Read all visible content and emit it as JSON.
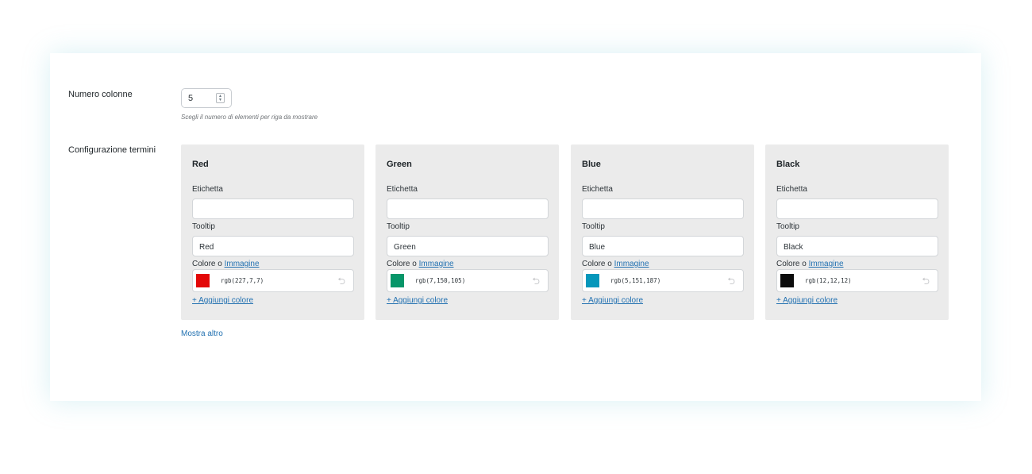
{
  "settings": {
    "columns_label": "Numero colonne",
    "columns_value": "5",
    "columns_hint": "Scegli il numero di elementi per riga da mostrare",
    "terms_label": "Configurazione termini",
    "show_more": "Mostra altro"
  },
  "card_labels": {
    "label_field": "Etichetta",
    "tooltip_field": "Tooltip",
    "color_prefix": "Colore o",
    "image_link": "Immagine",
    "add_color": "+ Aggiungi colore"
  },
  "terms": [
    {
      "name": "Red",
      "label_value": "",
      "tooltip_value": "Red",
      "color_code": "rgb(227,7,7)",
      "color_hex": "#e30707"
    },
    {
      "name": "Green",
      "label_value": "",
      "tooltip_value": "Green",
      "color_code": "rgb(7,150,105)",
      "color_hex": "#079669"
    },
    {
      "name": "Blue",
      "label_value": "",
      "tooltip_value": "Blue",
      "color_code": "rgb(5,151,187)",
      "color_hex": "#0597bb"
    },
    {
      "name": "Black",
      "label_value": "",
      "tooltip_value": "Black",
      "color_code": "rgb(12,12,12)",
      "color_hex": "#0c0c0c"
    }
  ],
  "icons": {
    "spinner": "number-spinner-icon",
    "reset": "undo-icon"
  }
}
